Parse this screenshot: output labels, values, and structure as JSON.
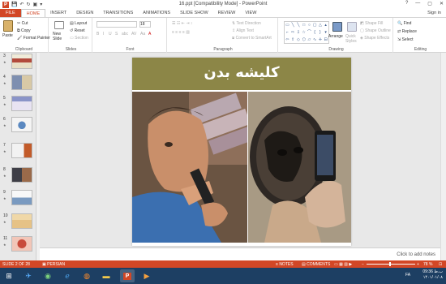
{
  "window": {
    "title": "16.ppt [Compatibility Mode] - PowerPoint",
    "controls": [
      "?",
      "—",
      "▢",
      "✕"
    ],
    "app_icon": "P"
  },
  "qat": [
    "💾",
    "↶",
    "↻",
    "▣",
    "▾"
  ],
  "tabs": [
    "FILE",
    "HOME",
    "INSERT",
    "DESIGN",
    "TRANSITIONS",
    "ANIMATIONS",
    "SLIDE SHOW",
    "REVIEW",
    "VIEW"
  ],
  "active_tab": "HOME",
  "sign_in": "Sign in",
  "ribbon": {
    "clipboard": {
      "label": "Clipboard",
      "paste": "Paste",
      "cut": "Cut",
      "copy": "Copy",
      "format_painter": "Format Painter"
    },
    "slides": {
      "label": "Slides",
      "new_slide": "New Slide",
      "layout": "Layout",
      "reset": "Reset",
      "section": "Section"
    },
    "font": {
      "label": "Font",
      "font_name": "",
      "font_size": "18",
      "bold": "B",
      "italic": "I",
      "underline": "U",
      "strike": "S",
      "shadow": "abc",
      "spacing": "AV",
      "case": "Aa",
      "color": "A"
    },
    "paragraph": {
      "label": "Paragraph",
      "text_direction": "Text Direction",
      "align_text": "Align Text",
      "smartart": "Convert to SmartArt"
    },
    "drawing": {
      "label": "Drawing",
      "arrange": "Arrange",
      "quick_styles": "Quick Styles",
      "shape_fill": "Shape Fill",
      "shape_outline": "Shape Outline",
      "shape_effects": "Shape Effects"
    },
    "editing": {
      "label": "Editing",
      "find": "Find",
      "replace": "Replace",
      "select": "Select"
    }
  },
  "thumbnails": [
    {
      "num": "3",
      "selected": false
    },
    {
      "num": "4",
      "selected": false
    },
    {
      "num": "5",
      "selected": false
    },
    {
      "num": "6",
      "selected": false
    },
    {
      "num": "7",
      "selected": false
    },
    {
      "num": "8",
      "selected": false
    },
    {
      "num": "9",
      "selected": false
    },
    {
      "num": "10",
      "selected": false
    },
    {
      "num": "11",
      "selected": false
    }
  ],
  "slide": {
    "title": "کلیشه بدن",
    "header_color": "#8c8647"
  },
  "notes_placeholder": "Click to add notes",
  "status": {
    "slide_info": "SLIDE 2 OF 28",
    "language": "PERSIAN",
    "notes": "NOTES",
    "comments": "COMMENTS",
    "zoom": "78 %"
  },
  "taskbar": {
    "items": [
      "start",
      "bird",
      "globe",
      "ie",
      "firefox",
      "folder",
      "powerpoint",
      "media"
    ],
    "lang": "FA",
    "time": "09:36 ب.ظ",
    "date": "۱۴۰۱/۰۱/۰۸"
  },
  "colors": {
    "accent": "#d24726",
    "taskbar": "#1d3f63"
  }
}
